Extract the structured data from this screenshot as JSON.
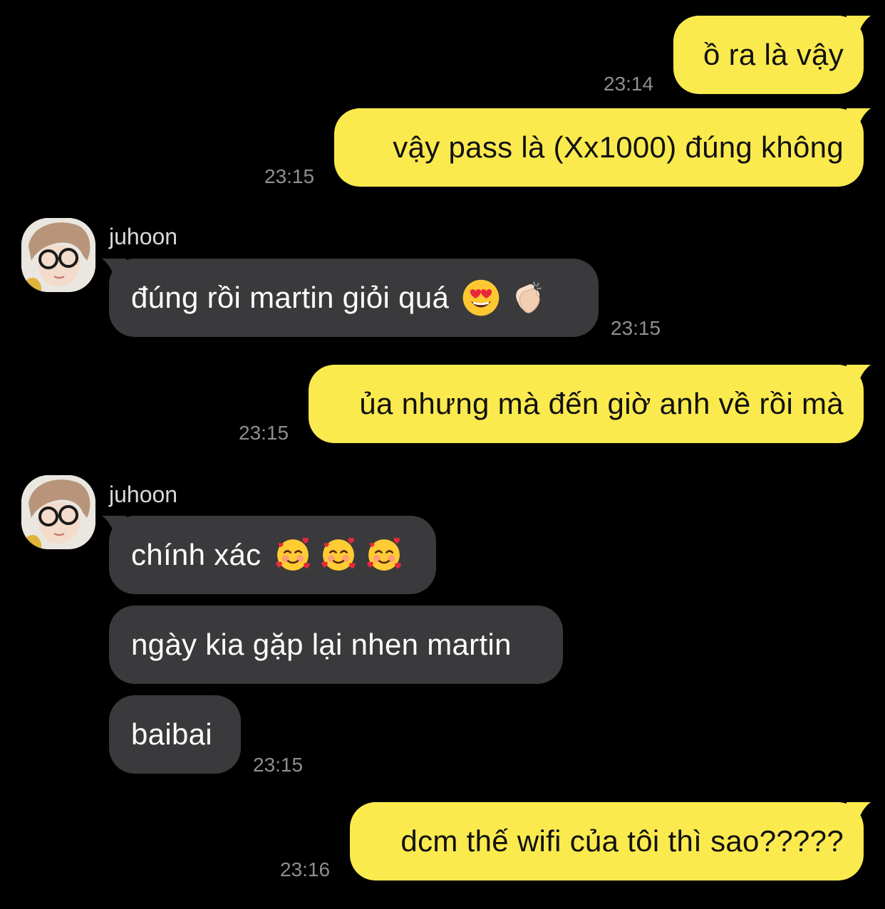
{
  "colors": {
    "background": "#000000",
    "outgoing_bubble": "#FBEA4E",
    "incoming_bubble": "#3A3A3C",
    "timestamp": "#8E8E93"
  },
  "contact": {
    "name": "juhoon"
  },
  "messages": [
    {
      "direction": "outgoing",
      "text": "ồ ra là vậy",
      "time": "23:14"
    },
    {
      "direction": "outgoing",
      "text": "vậy pass là (Xx1000) đúng không",
      "time": "23:15"
    },
    {
      "direction": "incoming",
      "sender": "juhoon",
      "text": "đúng rồi martin giỏi quá",
      "emojis": [
        "heart-eyes-emoji",
        "clapping-hands-emoji"
      ],
      "time": "23:15"
    },
    {
      "direction": "outgoing",
      "text": "ủa nhưng mà đến giờ anh về rồi mà",
      "time": "23:15"
    },
    {
      "direction": "incoming",
      "sender": "juhoon",
      "text": "chính xác",
      "emojis": [
        "smiling-face-with-hearts-emoji",
        "smiling-face-with-hearts-emoji",
        "smiling-face-with-hearts-emoji"
      ]
    },
    {
      "direction": "incoming",
      "text": "ngày kia gặp lại nhen martin"
    },
    {
      "direction": "incoming",
      "text": "baibai",
      "time": "23:15"
    },
    {
      "direction": "outgoing",
      "text": "dcm thế wifi của tôi thì sao?????",
      "time": "23:16"
    }
  ]
}
